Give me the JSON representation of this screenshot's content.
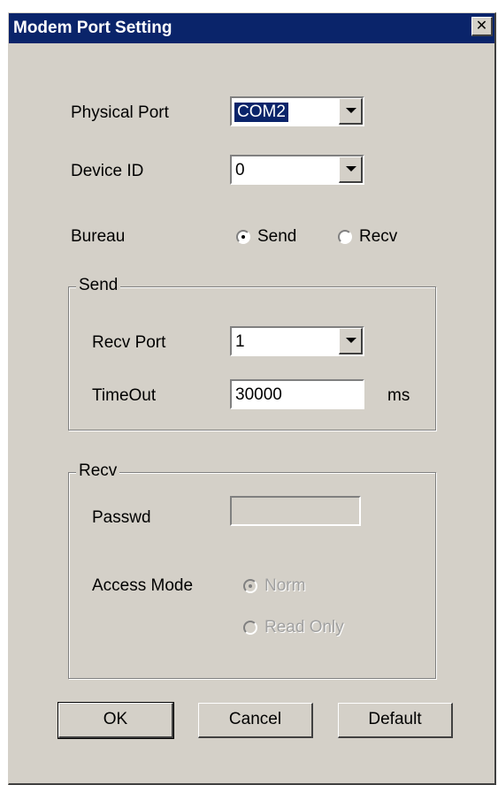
{
  "window": {
    "title": "Modem Port Setting"
  },
  "physical_port": {
    "label": "Physical Port",
    "value": "COM2"
  },
  "device_id": {
    "label": "Device ID",
    "value": "0"
  },
  "bureau": {
    "label": "Bureau",
    "options": [
      "Send",
      "Recv"
    ],
    "selected": "Send"
  },
  "send_group": {
    "legend": "Send",
    "recv_port": {
      "label": "Recv Port",
      "value": "1"
    },
    "timeout": {
      "label": "TimeOut",
      "value": "30000",
      "unit": "ms"
    }
  },
  "recv_group": {
    "legend": "Recv",
    "passwd": {
      "label": "Passwd",
      "value": ""
    },
    "access_mode": {
      "label": "Access Mode",
      "options": [
        "Norm",
        "Read Only"
      ],
      "selected": "Norm"
    }
  },
  "buttons": {
    "ok": "OK",
    "cancel": "Cancel",
    "default": "Default"
  }
}
